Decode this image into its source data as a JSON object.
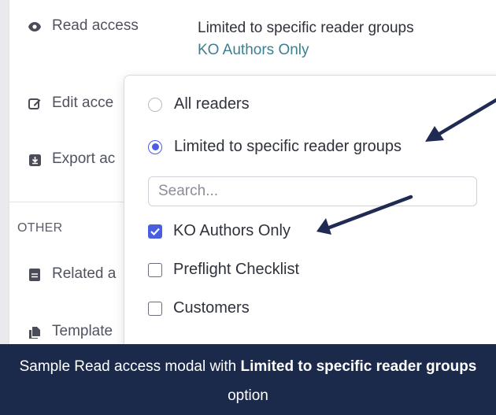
{
  "panel": {
    "rows": {
      "read_access": "Read access",
      "edit_access": "Edit acce",
      "export_access": "Export ac",
      "related": "Related a",
      "templates": "Template"
    },
    "read_value": {
      "main": "Limited to specific reader groups",
      "sub": "KO Authors Only"
    },
    "other_section": "OTHER"
  },
  "modal": {
    "options": {
      "all_readers": "All readers",
      "limited": "Limited to specific reader groups"
    },
    "selected_option": "limited",
    "search": {
      "placeholder": "Search...",
      "value": ""
    },
    "groups": [
      {
        "label": "KO Authors Only",
        "checked": true
      },
      {
        "label": "Preflight Checklist",
        "checked": false
      },
      {
        "label": "Customers",
        "checked": false
      }
    ]
  },
  "caption": {
    "part1": "Sample Read access modal with ",
    "bold": "Limited to specific reader groups",
    "part2": " option"
  },
  "colors": {
    "accent": "#4a5ee0",
    "caption_bg": "#1b2a4b",
    "arrow": "#1f2b52",
    "subtitle_teal": "#3d7f8e"
  },
  "icons": {
    "read_access": "eye-icon",
    "edit_access": "pencil-square-icon",
    "export_access": "download-box-icon",
    "related": "document-icon",
    "templates": "documents-icon",
    "annotation": "arrow-icon"
  }
}
